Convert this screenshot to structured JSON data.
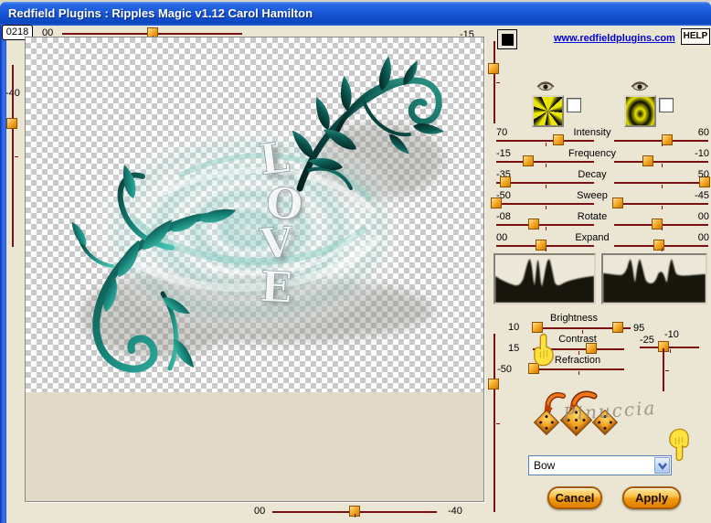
{
  "window": {
    "title": "Redfield Plugins : Ripples Magic v1.12   Carol Hamilton"
  },
  "counter": "0218",
  "top_slider": {
    "label": "00",
    "end_value": "-15"
  },
  "left_rail": {
    "label": "-40"
  },
  "bottom_slider": {
    "label": "00",
    "end_value": "-40"
  },
  "header": {
    "link": "www.redfieldplugins.com",
    "help": "HELP"
  },
  "params": {
    "rows": [
      {
        "left": "70",
        "label": "Intensity",
        "right": "60",
        "left_pos": 0.64,
        "right_pos": 0.56
      },
      {
        "left": "-15",
        "label": "Frequency",
        "right": "-10",
        "left_pos": 0.33,
        "right_pos": 0.36
      },
      {
        "left": "-35",
        "label": "Decay",
        "right": "50",
        "left_pos": 0.09,
        "right_pos": 0.96
      },
      {
        "left": "-50",
        "label": "Sweep",
        "right": "-45",
        "left_pos": 0.0,
        "right_pos": 0.04
      },
      {
        "left": "-08",
        "label": "Rotate",
        "right": "00",
        "left_pos": 0.38,
        "right_pos": 0.46
      },
      {
        "left": "00",
        "label": "Expand",
        "right": "00",
        "left_pos": 0.46,
        "right_pos": 0.48
      }
    ]
  },
  "adjust": {
    "brightness": {
      "label": "Brightness",
      "left": "10",
      "right": "95"
    },
    "contrast": {
      "label": "Contrast",
      "value": "15"
    },
    "refraction": {
      "label": "Refraction",
      "value": "-50"
    },
    "offset": {
      "x": "-25",
      "y": "-10"
    }
  },
  "slider_positions": {
    "top": 0.5,
    "bottom": 0.5,
    "left_rail": 0.32,
    "right_top_rail": 0.33,
    "right_bottom_rail": 0.28,
    "brightness_a": 0.05,
    "brightness_b": 0.87,
    "contrast": 0.64,
    "refraction": 0.01,
    "offset_x": 0.4
  },
  "signature": "Pinuccia",
  "preset_dropdown": {
    "value": "Bow"
  },
  "buttons": {
    "cancel": "Cancel",
    "apply": "Apply"
  },
  "preview": {
    "love": [
      "L",
      "O",
      "V",
      "E"
    ]
  },
  "icons": {
    "visibility": "eye",
    "texture_left": "starburst-pattern",
    "texture_right": "ripple-pattern",
    "combo_arrow": "chevron-down",
    "swatch": "black-square",
    "cursor": "pointing-hand",
    "decor": [
      "curved-arrows",
      "dice",
      "dice",
      "dice"
    ]
  },
  "colors": {
    "titlebar": "#1757d6",
    "dialog_bg": "#ebe5d4",
    "track": "#7a1012",
    "handle_orange": "#f6a823",
    "link": "#0000dd",
    "teal": "#17857a",
    "button_orange": "#f09a10"
  }
}
